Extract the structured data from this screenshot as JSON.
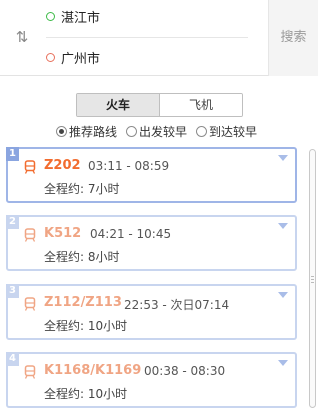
{
  "search": {
    "from_city": "湛江市",
    "to_city": "广州市",
    "button_label": "搜索",
    "swap_icon": "swap-vertical-icon"
  },
  "mode_tabs": [
    {
      "label": "火车",
      "active": true
    },
    {
      "label": "飞机",
      "active": false
    }
  ],
  "sort_options": [
    {
      "label": "推荐路线",
      "checked": true
    },
    {
      "label": "出发较早",
      "checked": false
    },
    {
      "label": "到达较早",
      "checked": false
    }
  ],
  "routes": [
    {
      "index": "1",
      "train": "Z202",
      "time": "03:11 - 08:59",
      "duration": "全程约: 7小时",
      "selected": true
    },
    {
      "index": "2",
      "train": "K512",
      "time": "04:21 - 10:45",
      "duration": "全程约: 8小时",
      "selected": false
    },
    {
      "index": "3",
      "train": "Z112/Z113",
      "time": "22:53 - 次日07:14",
      "duration": "全程约: 10小时",
      "selected": false
    },
    {
      "index": "4",
      "train": "K1168/K1169",
      "time": "00:38 - 08:30",
      "duration": "全程约: 10小时",
      "selected": false
    }
  ],
  "colors": {
    "selected_train": "#f26c2f",
    "train": "#f0a584",
    "card_border": "#c8d5ef",
    "from_dot": "#3dbb48",
    "to_dot": "#e8715d"
  }
}
